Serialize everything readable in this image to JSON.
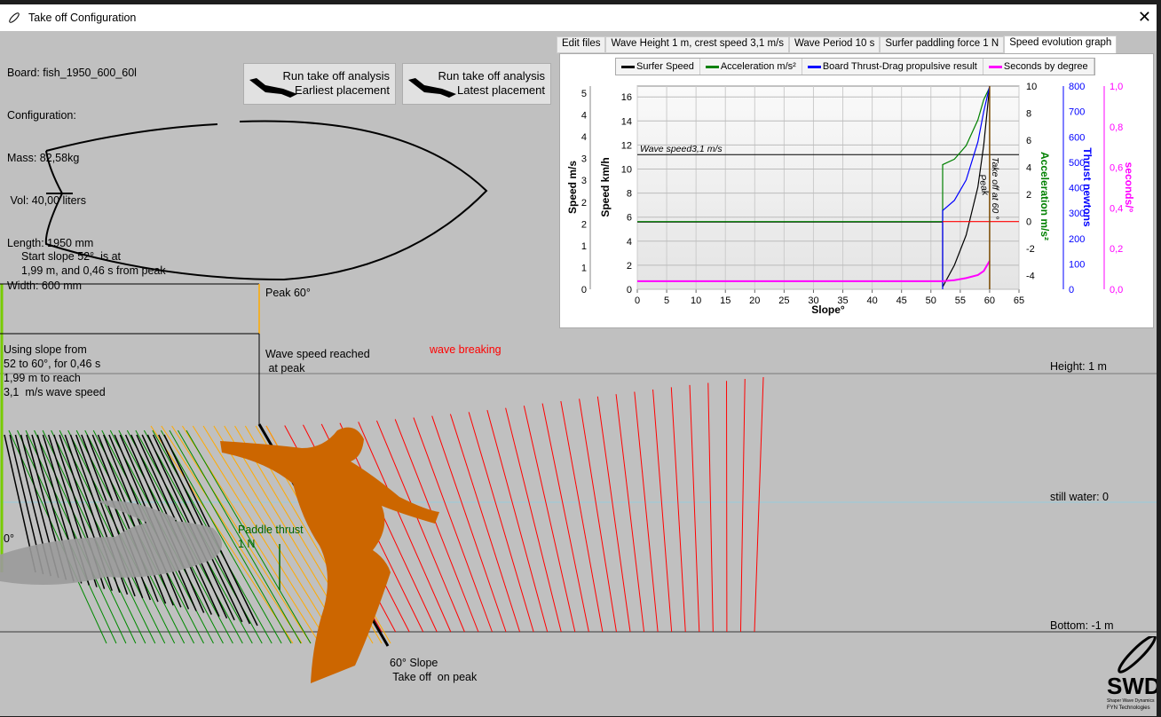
{
  "window": {
    "title": "Take off Configuration",
    "close": "✕"
  },
  "board": {
    "lines": [
      "Board: fish_1950_600_60l",
      "Configuration:",
      "Mass: 82,58kg",
      " Vol: 40,00 liters",
      "Length: 1950 mm",
      "Width: 600 mm"
    ]
  },
  "buttons": [
    {
      "label1": "Run take off analysis",
      "label2": "Earliest placement"
    },
    {
      "label1": "Run take off analysis",
      "label2": "Latest placement"
    }
  ],
  "tabs": [
    "Edit files",
    "Wave Height 1 m, crest speed 3,1  m/s",
    "Wave Period 10 s",
    "Surfer paddling force 1 N",
    "Speed evolution graph"
  ],
  "active_tab": 4,
  "scene": {
    "start_slope": "Start slope 52°  is at\n1,99 m, and 0,46 s from peak",
    "peak": "Peak 60°",
    "using_slope": "Using slope from\n52 to 60°, for 0,46 s\n1,99 m to reach\n3,1  m/s wave speed",
    "wave_speed_reached": "Wave speed reached\n at peak",
    "wave_breaking": "wave breaking",
    "height": "Height: 1 m",
    "still_water": "still water: 0",
    "bottom": "Bottom: -1 m",
    "zero_deg": "0°",
    "paddle_thrust": "Paddle thrust\n1 N",
    "slope_takeoff": "60° Slope\n Take off  on peak",
    "logo_text": "SWD Shaper Wave Dynamics FYN Technologies"
  },
  "colors": {
    "background": "#c0c0c0",
    "wave_breaking": "#ff0000",
    "paddle": "#006400",
    "surfer": "#cc6600",
    "orange_lines": "#ffa500",
    "green_lines": "#008000"
  },
  "chart_data": {
    "type": "line",
    "xlabel": "Slope°",
    "xlim": [
      0,
      65
    ],
    "xticks": [
      0,
      5,
      10,
      15,
      20,
      25,
      30,
      35,
      40,
      45,
      50,
      55,
      60,
      65
    ],
    "axes": {
      "speed_ms": {
        "label": "Speed m/s",
        "ticks": [
          "5",
          "4",
          "4",
          "3",
          "3",
          "2",
          "2",
          "1",
          "1",
          "0"
        ]
      },
      "speed_kmh": {
        "label": "Speed km/h",
        "range": [
          0,
          16.9
        ],
        "ticks": [
          0,
          2,
          4,
          6,
          8,
          10,
          12,
          14,
          16
        ]
      },
      "acceleration": {
        "label": "Acceleration m/s²",
        "range": [
          -5,
          10
        ],
        "ticks": [
          -4,
          -2,
          0,
          2,
          4,
          6,
          8,
          10
        ],
        "color": "#008000"
      },
      "thrust": {
        "label": "Thrust newtons",
        "range": [
          0,
          800
        ],
        "ticks": [
          0,
          100,
          200,
          300,
          400,
          500,
          600,
          700,
          800
        ],
        "color": "#0000ff"
      },
      "seconds": {
        "label": "seconds/°",
        "range": [
          0,
          1
        ],
        "ticks": [
          "0,0",
          "0,2",
          "0,4",
          "0,6",
          "0,8",
          "1,0"
        ],
        "color": "#ff00ff"
      }
    },
    "legend": [
      "Surfer Speed",
      "Acceleration m/s²",
      "Board Thrust-Drag propulsive result",
      "Seconds by degree"
    ],
    "legend_placement": "top",
    "annotations": {
      "wave_speed": "Wave speed3,1 m/s",
      "wave_speed_kmh": 11.2,
      "takeoff": "Take off at 60 °",
      "peak": "Peak",
      "takeoff_slope": 60
    },
    "series": [
      {
        "name": "Surfer Speed",
        "color": "#000000",
        "axis": "speed_kmh",
        "x": [
          0,
          52,
          52,
          54,
          56,
          58,
          59,
          60
        ],
        "y": [
          5.6,
          5.6,
          0.2,
          2,
          4.5,
          8.5,
          12,
          16.9
        ]
      },
      {
        "name": "Acceleration m/s²",
        "color": "#008000",
        "axis": "acceleration",
        "x": [
          0,
          52,
          52,
          54,
          56,
          58,
          59,
          60
        ],
        "y": [
          0,
          0,
          4.2,
          4.6,
          5.6,
          7.5,
          9,
          9.9
        ]
      },
      {
        "name": "Board Thrust-Drag propulsive result",
        "color": "#0000ff",
        "axis": "thrust",
        "x": [
          52,
          52,
          54,
          56,
          58,
          59,
          60
        ],
        "y": [
          0,
          310,
          350,
          430,
          580,
          700,
          800
        ]
      },
      {
        "name": "Seconds by degree",
        "color": "#ff00ff",
        "axis": "seconds",
        "x": [
          0,
          52,
          54,
          56,
          58,
          59,
          60
        ],
        "y": [
          0.04,
          0.04,
          0.045,
          0.055,
          0.07,
          0.09,
          0.14
        ]
      },
      {
        "name": "",
        "color": "#ff0000",
        "axis": "acceleration",
        "x": [
          52,
          65
        ],
        "y": [
          0,
          0
        ]
      }
    ]
  }
}
